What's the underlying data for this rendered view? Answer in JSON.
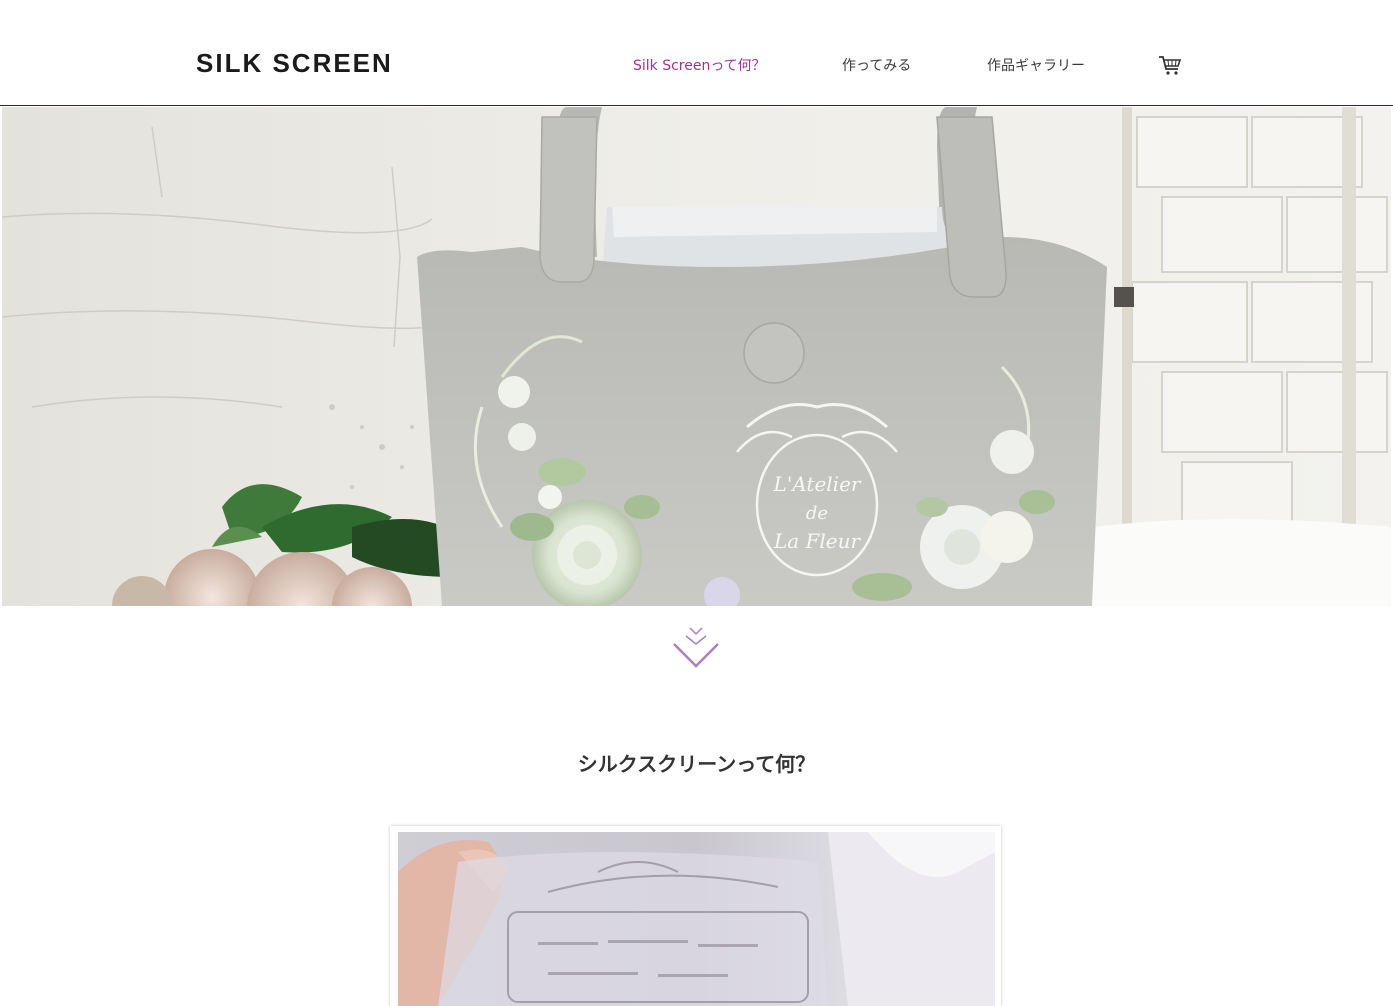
{
  "header": {
    "logo": "SILK SCREEN",
    "nav": [
      {
        "label": "Silk Screenって何？",
        "active": true
      },
      {
        "label": "作ってみる",
        "active": false
      },
      {
        "label": "作品ギャラリー",
        "active": false
      }
    ],
    "cart_icon": "cart-icon"
  },
  "hero": {
    "medallion_line1": "L'Atelier",
    "medallion_line2": "de",
    "medallion_line3": "La Fleur"
  },
  "scroll_icon": "chevron-double-down-icon",
  "section": {
    "title": "シルクスクリーンって何？"
  },
  "colors": {
    "accent": "#a0338e",
    "chevron": "#a782b8",
    "text": "#333333"
  }
}
